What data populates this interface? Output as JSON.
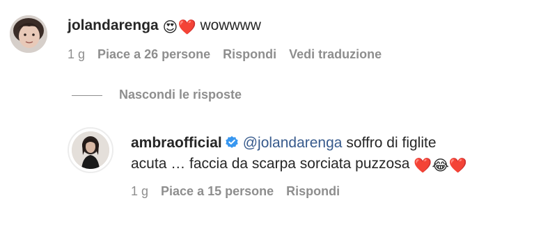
{
  "comment": {
    "username": "jolandarenga",
    "emojis": "😍❤️",
    "text": "wowwww",
    "time": "1 g",
    "likes": "Piace a 26 persone",
    "reply": "Rispondi",
    "translate": "Vedi traduzione"
  },
  "hide_replies": "Nascondi le risposte",
  "reply": {
    "username": "ambraofficial",
    "mention": "@jolandarenga",
    "text_line1": "soffro di figlite",
    "text_line2": "acuta … faccia da scarpa sorciata puzzosa",
    "emojis": "❤️😂❤️",
    "time": "1 g",
    "likes": "Piace a 15 persone",
    "reply_action": "Rispondi"
  }
}
